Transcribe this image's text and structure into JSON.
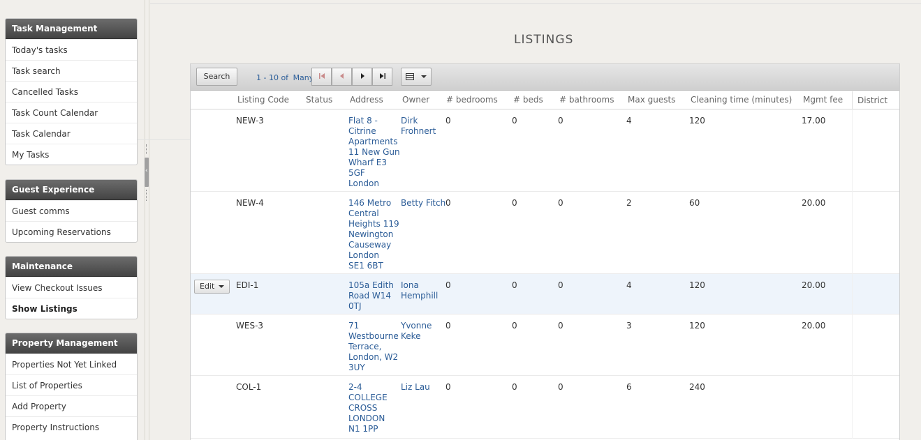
{
  "sidebar": {
    "sections": [
      {
        "title": "Task Management",
        "items": [
          "Today's tasks",
          "Task search",
          "Cancelled Tasks",
          "Task Count Calendar",
          "Task Calendar",
          "My Tasks"
        ]
      },
      {
        "title": "Guest Experience",
        "items": [
          "Guest comms",
          "Upcoming Reservations"
        ]
      },
      {
        "title": "Maintenance",
        "items": [
          "View Checkout Issues",
          "Show Listings"
        ]
      },
      {
        "title": "Property Management",
        "items": [
          "Properties Not Yet Linked",
          "List of Properties",
          "Add Property",
          "Property Instructions"
        ]
      }
    ],
    "active_item": "Show Listings"
  },
  "page": {
    "title": "LISTINGS"
  },
  "toolbar": {
    "search_label": "Search",
    "pager_range": "1 - 10 of",
    "pager_total": "Many"
  },
  "table": {
    "columns": [
      "Listing Code",
      "Status",
      "Address",
      "Owner",
      "# bedrooms",
      "# beds",
      "# bathrooms",
      "Max guests",
      "Cleaning time (minutes)",
      "Mgmt fee",
      "District"
    ],
    "rows": [
      {
        "code": "NEW-3",
        "status": "",
        "address": [
          "Flat 8 -",
          "Citrine",
          "Apartments",
          "11 New Gun",
          "Wharf E3",
          "5GF",
          "London"
        ],
        "owner": [
          "Dirk",
          "Frohnert"
        ],
        "bedrooms": "0",
        "beds": "0",
        "bathrooms": "0",
        "max_guests": "4",
        "cleaning": "120",
        "fee": "17.00",
        "district": ""
      },
      {
        "code": "NEW-4",
        "status": "",
        "address": [
          "146 Metro",
          "Central",
          "Heights 119",
          "Newington",
          "Causeway",
          "London",
          "SE1 6BT"
        ],
        "owner": [
          "Betty Fitch"
        ],
        "bedrooms": "0",
        "beds": "0",
        "bathrooms": "0",
        "max_guests": "2",
        "cleaning": "60",
        "fee": "20.00",
        "district": ""
      },
      {
        "code": "EDI-1",
        "status": "",
        "address": [
          "105a Edith",
          "Road W14",
          "0TJ"
        ],
        "owner": [
          "Iona",
          "Hemphill"
        ],
        "bedrooms": "0",
        "beds": "0",
        "bathrooms": "0",
        "max_guests": "4",
        "cleaning": "120",
        "fee": "20.00",
        "district": "",
        "edit_label": "Edit"
      },
      {
        "code": "WES-3",
        "status": "",
        "address": [
          "71",
          "Westbourne",
          "Terrace,",
          "London, W2",
          "3UY"
        ],
        "owner": [
          "Yvonne",
          "Keke"
        ],
        "bedrooms": "0",
        "beds": "0",
        "bathrooms": "0",
        "max_guests": "3",
        "cleaning": "120",
        "fee": "20.00",
        "district": ""
      },
      {
        "code": "COL-1",
        "status": "",
        "address": [
          "2-4",
          "COLLEGE",
          "CROSS",
          "LONDON",
          "N1 1PP"
        ],
        "owner": [
          "Liz Lau"
        ],
        "bedrooms": "0",
        "beds": "0",
        "bathrooms": "0",
        "max_guests": "6",
        "cleaning": "240",
        "fee": "",
        "district": ""
      }
    ]
  },
  "icons": {
    "first": "first-page-icon",
    "prev": "prev-page-icon",
    "next": "next-page-icon",
    "last": "last-page-icon",
    "view": "column-view-icon"
  }
}
